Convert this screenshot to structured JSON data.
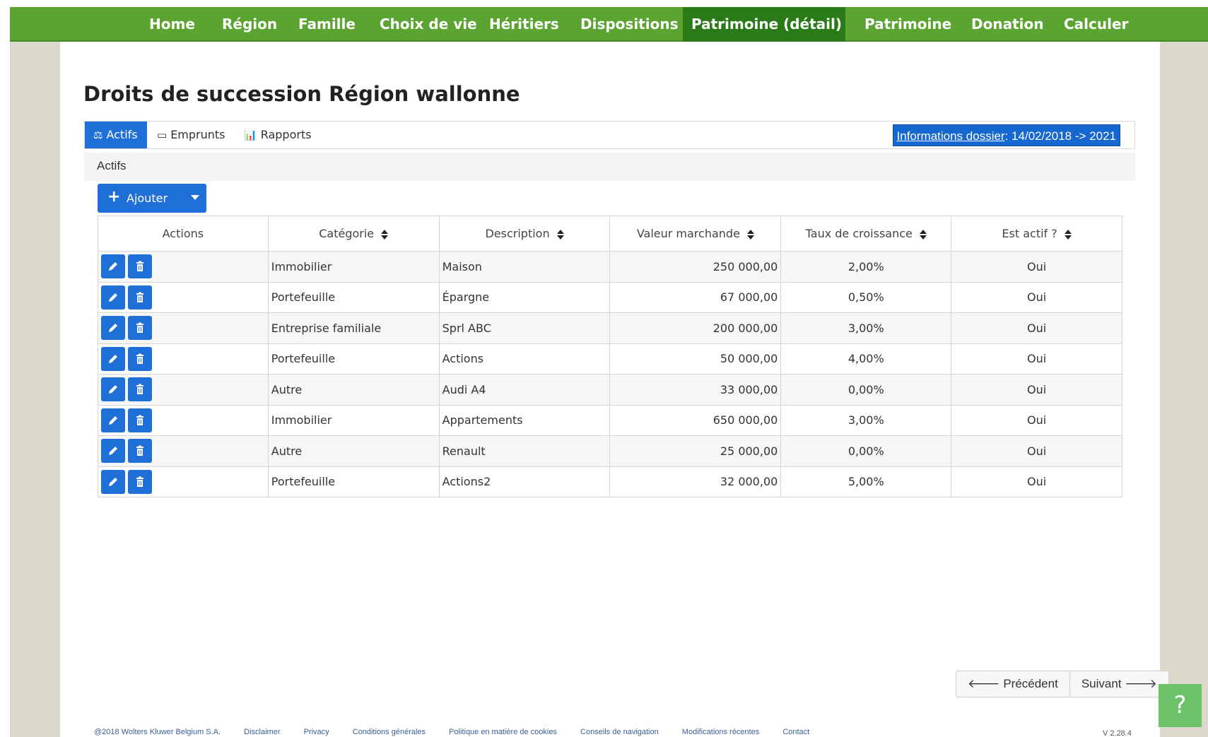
{
  "nav": {
    "items": [
      {
        "label": "Home",
        "active": false
      },
      {
        "label": "Région",
        "active": false
      },
      {
        "label": "Famille",
        "active": false
      },
      {
        "label": "Choix de vie",
        "active": false
      },
      {
        "label": "Héritiers",
        "active": false
      },
      {
        "label": "Dispositions",
        "active": false
      },
      {
        "label": "Patrimoine (détail)",
        "active": true
      },
      {
        "label": "Patrimoine",
        "active": false
      },
      {
        "label": "Donation",
        "active": false
      },
      {
        "label": "Calculer",
        "active": false
      }
    ]
  },
  "page": {
    "title": "Droits de succession Région wallonne"
  },
  "tabs": [
    {
      "label": "Actifs",
      "icon": "assets-icon",
      "active": true
    },
    {
      "label": "Emprunts",
      "icon": "card-icon",
      "active": false
    },
    {
      "label": "Rapports",
      "icon": "bar-chart-icon",
      "active": false
    }
  ],
  "dossier": {
    "link_label": "Informations dossier",
    "value": ": 14/02/2018 -> 2021"
  },
  "section": {
    "label": "Actifs"
  },
  "add_button": {
    "label": "Ajouter"
  },
  "table": {
    "headers": [
      "Actions",
      "Catégorie",
      "Description",
      "Valeur marchande",
      "Taux de croissance",
      "Est actif ?"
    ],
    "rows": [
      {
        "categorie": "Immobilier",
        "description": "Maison",
        "valeur": "250 000,00",
        "taux": "2,00%",
        "actif": "Oui"
      },
      {
        "categorie": "Portefeuille",
        "description": "Épargne",
        "valeur": "67 000,00",
        "taux": "0,50%",
        "actif": "Oui"
      },
      {
        "categorie": "Entreprise familiale",
        "description": "Sprl ABC",
        "valeur": "200 000,00",
        "taux": "3,00%",
        "actif": "Oui"
      },
      {
        "categorie": "Portefeuille",
        "description": "Actions",
        "valeur": "50 000,00",
        "taux": "4,00%",
        "actif": "Oui"
      },
      {
        "categorie": "Autre",
        "description": "Audi A4",
        "valeur": "33 000,00",
        "taux": "0,00%",
        "actif": "Oui"
      },
      {
        "categorie": "Immobilier",
        "description": "Appartements",
        "valeur": "650 000,00",
        "taux": "3,00%",
        "actif": "Oui"
      },
      {
        "categorie": "Autre",
        "description": "Renault",
        "valeur": "25 000,00",
        "taux": "0,00%",
        "actif": "Oui"
      },
      {
        "categorie": "Portefeuille",
        "description": "Actions2",
        "valeur": "32 000,00",
        "taux": "5,00%",
        "actif": "Oui"
      }
    ]
  },
  "pager": {
    "prev_label": "Précédent",
    "next_label": "Suivant"
  },
  "help": {
    "label": "?"
  },
  "footer": {
    "copyright": "@2018 Wolters Kluwer Belgium S.A.",
    "links": [
      "Disclaimer",
      "Privacy",
      "Conditions générales",
      "Politique en matière de cookies",
      "Conseils de navigation",
      "Modifications récentes",
      "Contact"
    ],
    "version": "V 2.28.4"
  },
  "colors": {
    "nav_green": "#5ba432",
    "nav_active": "#2a7a1a",
    "primary_blue": "#1f6fd8",
    "help_green": "#6cc16a"
  }
}
